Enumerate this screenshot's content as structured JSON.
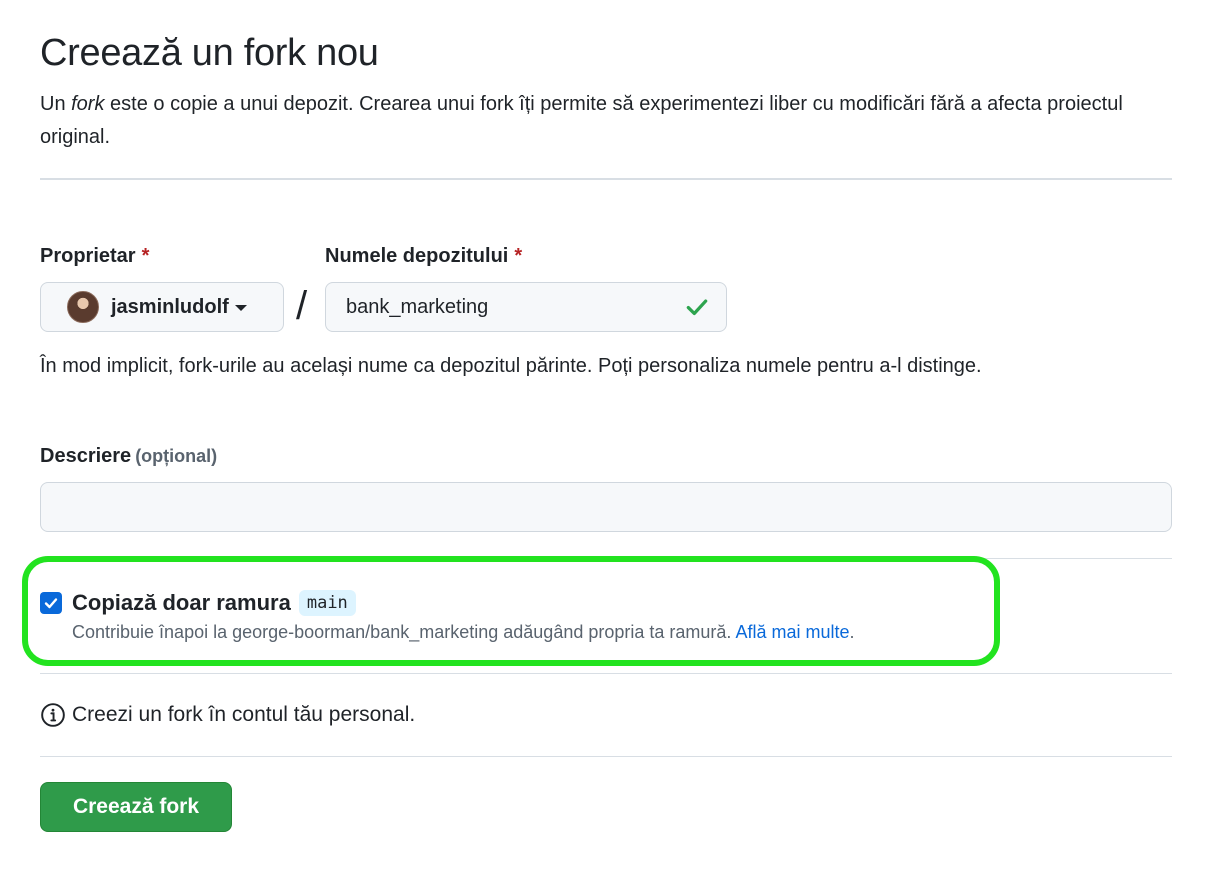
{
  "page": {
    "title": "Creează un fork nou",
    "lead_prefix": "Un ",
    "lead_em": "fork",
    "lead_rest": " este o copie a unui depozit. Crearea unui fork îți permite să experimentezi liber cu modificări fără a afecta proiectul original."
  },
  "owner": {
    "label": "Proprietar",
    "required_mark": "*",
    "selected": "jasminludolf"
  },
  "repo_name": {
    "label": "Numele depozitului",
    "required_mark": "*",
    "value": "bank_marketing",
    "valid_icon": "check-icon"
  },
  "separator": "/",
  "hint": "În mod implicit, fork-urile au același nume ca depozitul părinte. Poți personaliza numele pentru a-l distinge.",
  "description": {
    "label": "Descriere",
    "optional": "(opțional)",
    "value": ""
  },
  "branch_option": {
    "checked": true,
    "label": "Copiază doar ramura",
    "branch": "main",
    "note": "Contribuie înapoi la george-boorman/bank_marketing adăugând propria ta ramură.",
    "link": "Află mai multe",
    "note_end": ".",
    "highlight_color": "#22e31f"
  },
  "info": {
    "text": "Creezi un fork în contul tău personal.",
    "icon": "info-icon"
  },
  "submit": {
    "label": "Creează fork",
    "color": "#2f9b4a"
  }
}
